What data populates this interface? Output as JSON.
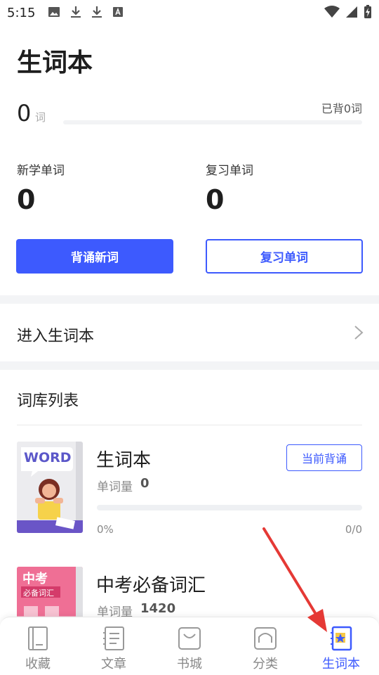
{
  "status_bar": {
    "time": "5:15",
    "left_icons": [
      "image-icon",
      "download-icon",
      "download-icon",
      "font-icon"
    ],
    "right_icons": [
      "wifi-icon",
      "signal-icon",
      "battery-icon"
    ]
  },
  "header": {
    "title": "生词本"
  },
  "summary": {
    "count": "0",
    "count_unit": "词",
    "memorized_label": "已背0词",
    "progress_fraction": 0
  },
  "stats": {
    "new_label": "新学单词",
    "new_value": "0",
    "review_label": "复习单词",
    "review_value": "0"
  },
  "actions": {
    "memorize_new": "背诵新词",
    "review_words": "复习单词"
  },
  "enter_notebook": {
    "label": "进入生词本"
  },
  "library": {
    "title": "词库列表",
    "books": [
      {
        "name": "生词本",
        "count_label": "单词量",
        "count": "0",
        "badge": "当前背诵",
        "percent": "0%",
        "ratio": "0/0",
        "progress_fraction": 0,
        "cover_text": "WORD"
      },
      {
        "name": "中考必备词汇",
        "count_label": "单词量",
        "count": "1420",
        "cover_title": "中考",
        "cover_subtitle": "必备词汇"
      }
    ]
  },
  "bottom_nav": {
    "items": [
      {
        "label": "收藏",
        "icon": "bookmark-icon"
      },
      {
        "label": "文章",
        "icon": "article-icon"
      },
      {
        "label": "书城",
        "icon": "bookstore-icon"
      },
      {
        "label": "分类",
        "icon": "category-icon"
      },
      {
        "label": "生词本",
        "icon": "vocab-book-icon",
        "active": true
      }
    ]
  },
  "colors": {
    "accent": "#3d5afe",
    "annotation_arrow": "#e53935"
  }
}
